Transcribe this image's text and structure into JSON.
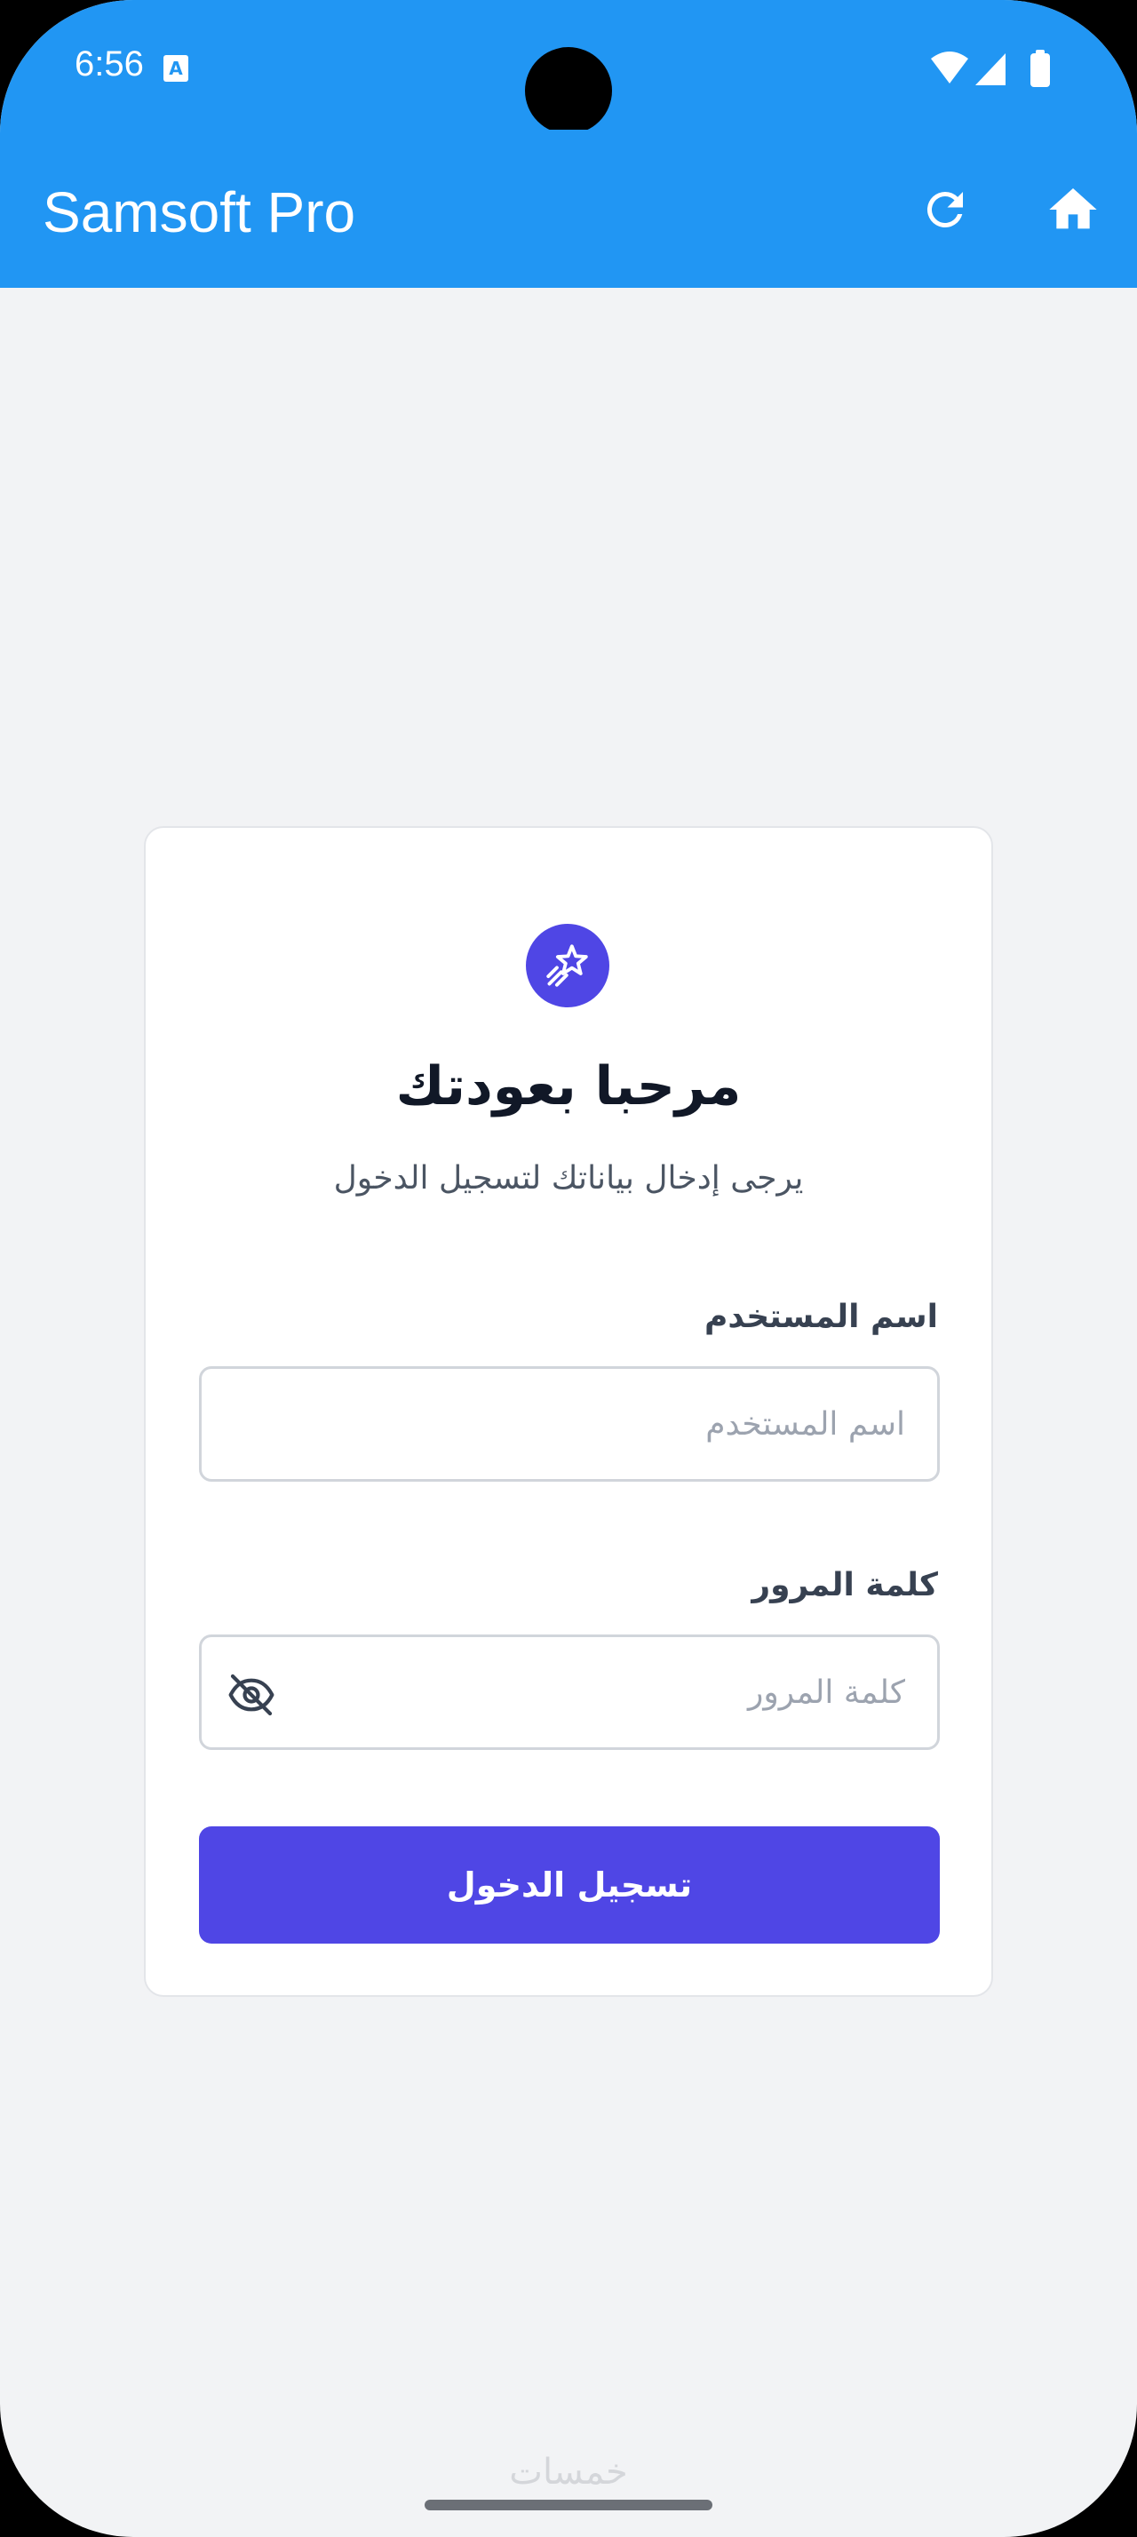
{
  "status_bar": {
    "time": "6:56",
    "icons": [
      "a-notification-icon",
      "wifi-icon",
      "signal-icon",
      "battery-icon"
    ]
  },
  "app_bar": {
    "title": "Samsoft Pro",
    "color": "#2196f3",
    "actions": [
      "refresh-icon",
      "home-icon"
    ]
  },
  "login_card": {
    "logo_icon": "shooting-star-icon",
    "title": "مرحبا بعودتك",
    "subtitle": "يرجى إدخال بياناتك لتسجيل الدخول",
    "username_label": "اسم المستخدم",
    "username_placeholder": "اسم المستخدم",
    "username_value": "",
    "password_label": "كلمة المرور",
    "password_placeholder": "كلمة المرور",
    "password_value": "",
    "password_toggle_icon": "eye-off-icon",
    "login_button": "تسجيل الدخول",
    "accent_color": "#4f46e5"
  },
  "watermark": "خمسات"
}
